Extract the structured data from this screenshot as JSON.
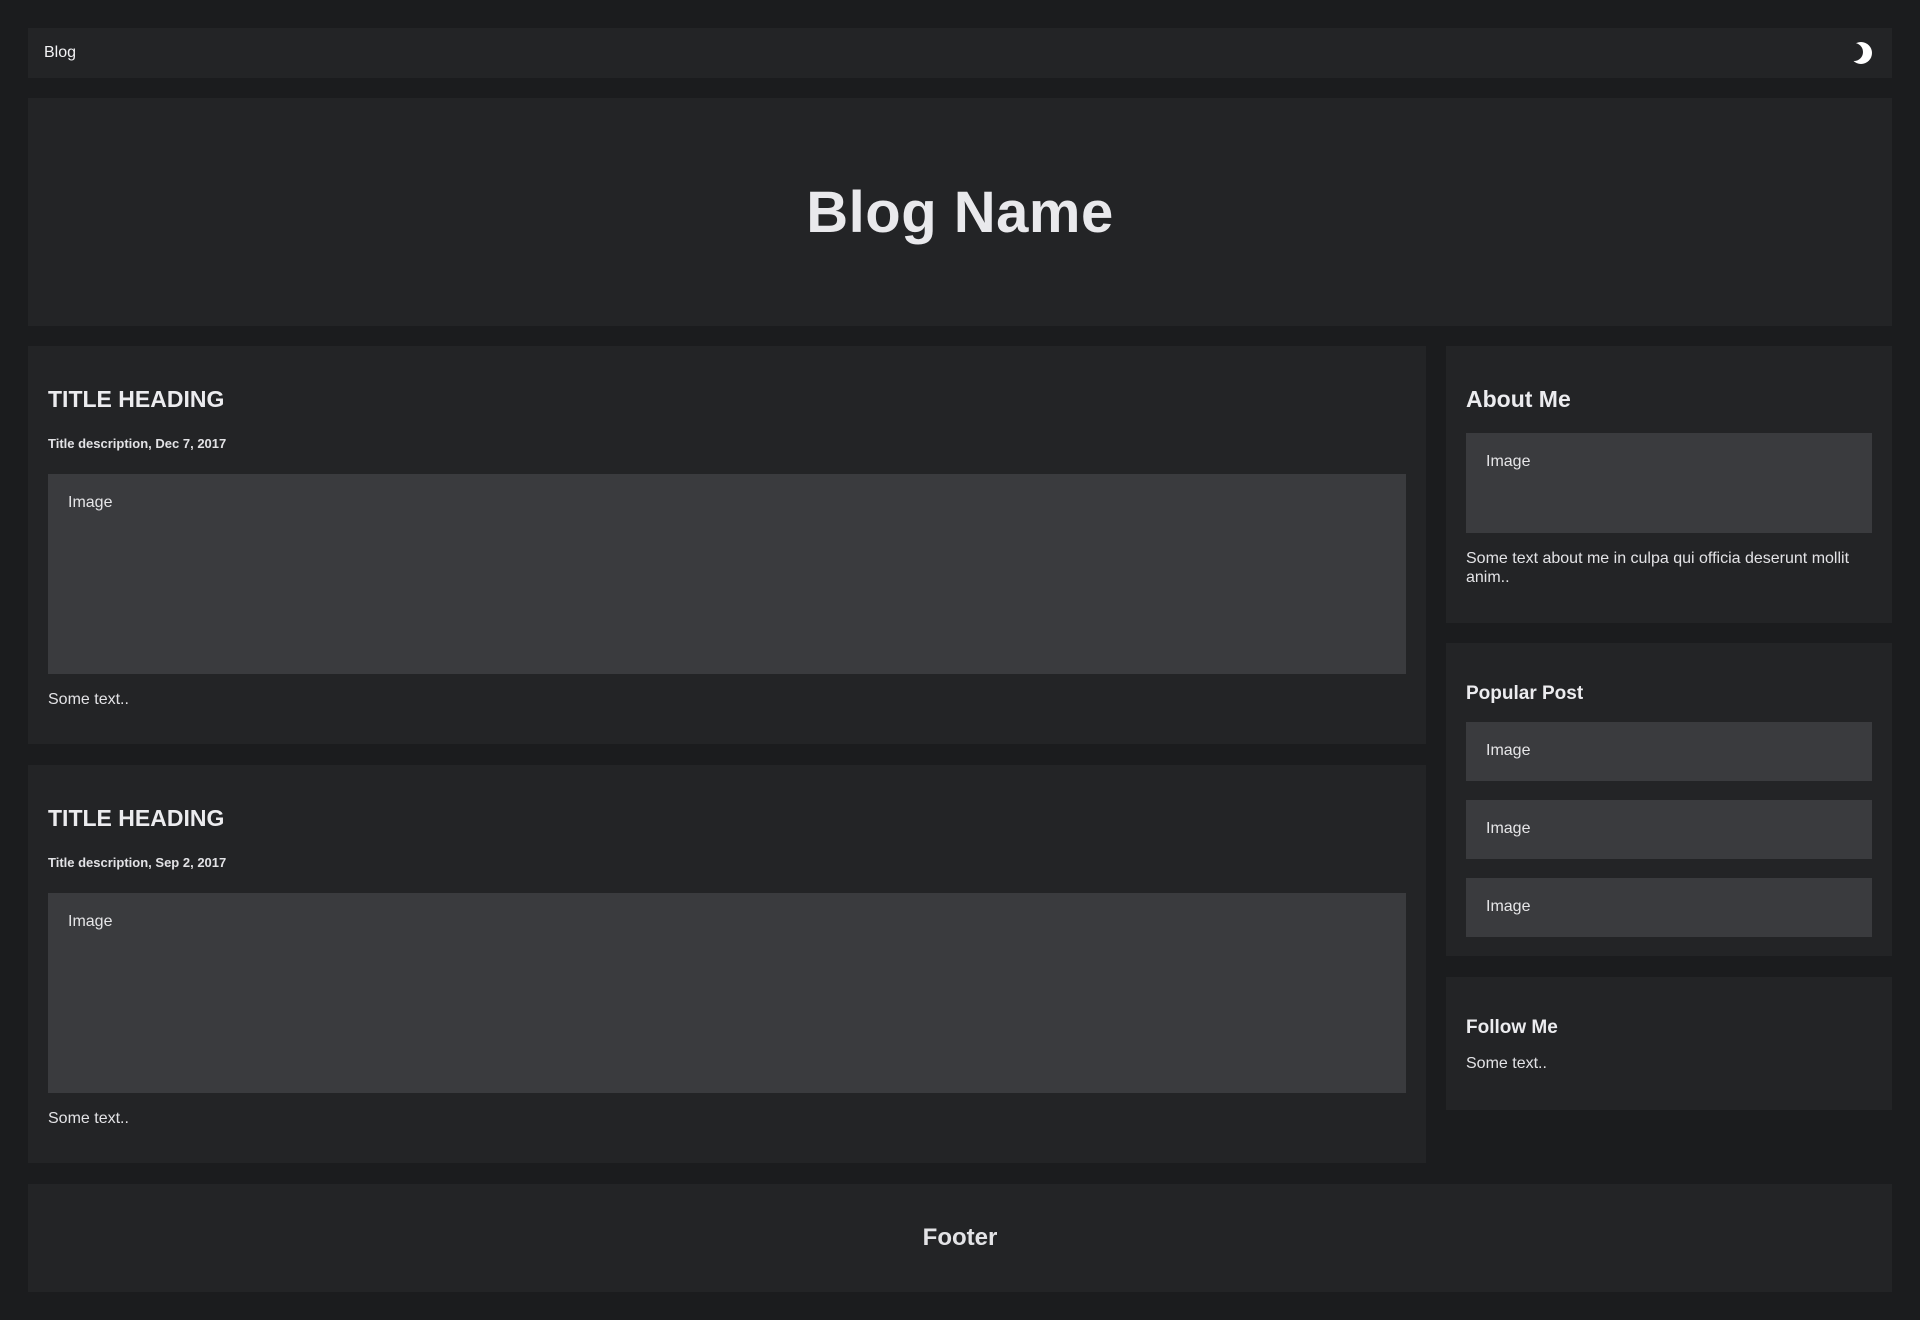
{
  "nav": {
    "brand": "Blog",
    "theme_icon": "moon-icon"
  },
  "header": {
    "title": "Blog Name"
  },
  "posts": [
    {
      "title": "TITLE HEADING",
      "description": "Title description,",
      "date": "Dec 7, 2017",
      "image_label": "Image",
      "text": "Some text.."
    },
    {
      "title": "TITLE HEADING",
      "description": "Title description,",
      "date": "Sep 2, 2017",
      "image_label": "Image",
      "text": "Some text.."
    }
  ],
  "sidebar": {
    "about": {
      "heading": "About Me",
      "image_label": "Image",
      "text": "Some text about me in culpa qui officia deserunt mollit anim.."
    },
    "popular": {
      "heading": "Popular Post",
      "items": [
        {
          "label": "Image"
        },
        {
          "label": "Image"
        },
        {
          "label": "Image"
        }
      ]
    },
    "follow": {
      "heading": "Follow Me",
      "text": "Some text.."
    }
  },
  "footer": {
    "text": "Footer"
  },
  "colors": {
    "page_bg": "#1b1c1e",
    "panel_bg": "#232426",
    "image_bg": "#3a3b3e",
    "text": "#e8e8ea"
  }
}
